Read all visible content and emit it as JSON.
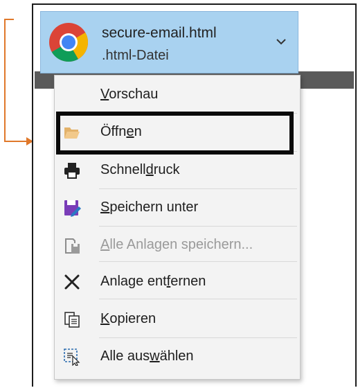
{
  "attachment": {
    "file_name": "secure-email.html",
    "file_type": ".html-Datei",
    "app_icon": "chrome-icon",
    "dropdown_icon": "chevron-down-icon"
  },
  "menu": {
    "items": [
      {
        "pre": "",
        "u": "V",
        "post": "orschau",
        "icon": "none",
        "enabled": true
      },
      {
        "pre": "Öffn",
        "u": "e",
        "post": "n",
        "icon": "folder-open-icon",
        "enabled": true,
        "highlighted": true
      },
      {
        "pre": "Schnell",
        "u": "d",
        "post": "ruck",
        "icon": "printer-icon",
        "enabled": true
      },
      {
        "pre": "",
        "u": "S",
        "post": "peichern unter",
        "icon": "save-as-icon",
        "enabled": true
      },
      {
        "pre": "",
        "u": "A",
        "post": "lle Anlagen speichern...",
        "icon": "save-all-icon",
        "enabled": false
      },
      {
        "pre": "Anlage ent",
        "u": "f",
        "post": "ernen",
        "icon": "remove-icon",
        "enabled": true
      },
      {
        "pre": "",
        "u": "K",
        "post": "opieren",
        "icon": "copy-icon",
        "enabled": true
      },
      {
        "pre": "Alle aus",
        "u": "w",
        "post": "ählen",
        "icon": "select-all-icon",
        "enabled": true
      }
    ]
  },
  "colors": {
    "attachment_bg": "#a9d2f0",
    "menu_bg": "#f3f3f3",
    "callout": "#e0782a",
    "highlight_border": "#0a0a0a",
    "save_icon_purple": "#7a3db8"
  }
}
